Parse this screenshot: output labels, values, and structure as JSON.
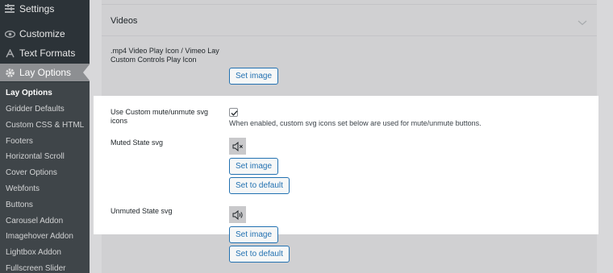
{
  "sidebar": {
    "menu": [
      {
        "label": "Settings",
        "icon": "settings-icon"
      },
      {
        "label": "Customize",
        "icon": "eye-icon"
      },
      {
        "label": "Text Formats",
        "icon": "text-formats-icon"
      },
      {
        "label": "Lay Options",
        "icon": "gear-icon",
        "active": true
      }
    ],
    "submenu": [
      "Lay Options",
      "Gridder Defaults",
      "Custom CSS & HTML",
      "Footers",
      "Horizontal Scroll",
      "Cover Options",
      "Webfonts",
      "Buttons",
      "Carousel Addon",
      "Imagehover Addon",
      "Lightbox Addon",
      "Fullscreen Slider"
    ]
  },
  "main": {
    "section_title": "Videos",
    "video_play_icon": {
      "label": ".mp4 Video Play Icon / Vimeo Lay Custom Controls Play Icon",
      "button": "Set image"
    },
    "custom_mute": {
      "label": "Use Custom mute/unmute svg icons",
      "checked": true,
      "hint": "When enabled, custom svg icons set below are used for mute/unmute buttons."
    },
    "muted_state": {
      "label": "Muted State svg",
      "set_button": "Set image",
      "default_button": "Set to default"
    },
    "unmuted_state": {
      "label": "Unmuted State svg",
      "set_button": "Set image",
      "default_button": "Set to default"
    }
  },
  "colors": {
    "sidebar": "#2c3338",
    "submenu": "#3f4549",
    "accent": "#2271b1",
    "highlight": "#ffffff"
  }
}
